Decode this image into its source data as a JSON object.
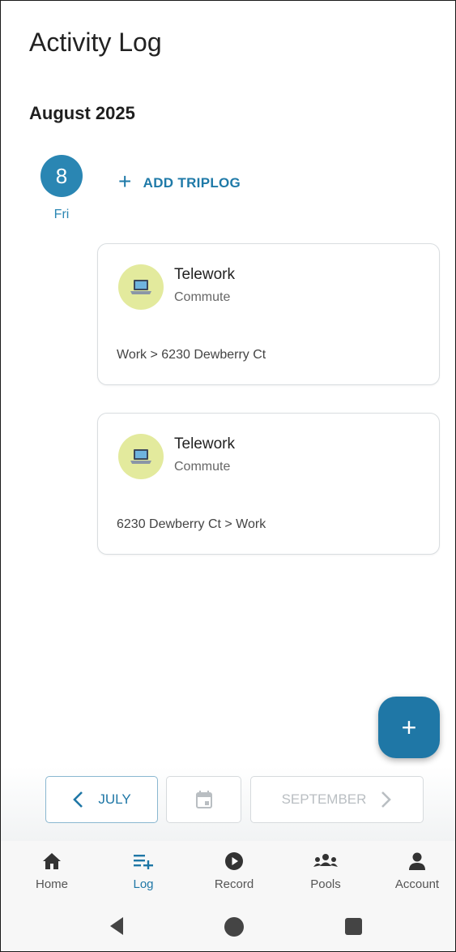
{
  "header": {
    "title": "Activity Log"
  },
  "month": {
    "title": "August 2025"
  },
  "day": {
    "number": "8",
    "weekday": "Fri",
    "add_label": "ADD TRIPLOG"
  },
  "trips": [
    {
      "mode": "Telework",
      "purpose": "Commute",
      "route": "Work > 6230 Dewberry Ct",
      "icon": "laptop-icon"
    },
    {
      "mode": "Telework",
      "purpose": "Commute",
      "route": "6230 Dewberry Ct > Work",
      "icon": "laptop-icon"
    }
  ],
  "month_nav": {
    "prev_label": "JULY",
    "next_label": "SEPTEMBER",
    "calendar_icon": "calendar-icon"
  },
  "bottom_nav": [
    {
      "label": "Home",
      "icon": "home-icon",
      "active": false
    },
    {
      "label": "Log",
      "icon": "log-icon",
      "active": true
    },
    {
      "label": "Record",
      "icon": "record-icon",
      "active": false
    },
    {
      "label": "Pools",
      "icon": "pools-icon",
      "active": false
    },
    {
      "label": "Account",
      "icon": "account-icon",
      "active": false
    }
  ],
  "colors": {
    "accent": "#1f77a6",
    "icon_bg": "#e3ea9d",
    "day_circle": "#2a86b3"
  }
}
